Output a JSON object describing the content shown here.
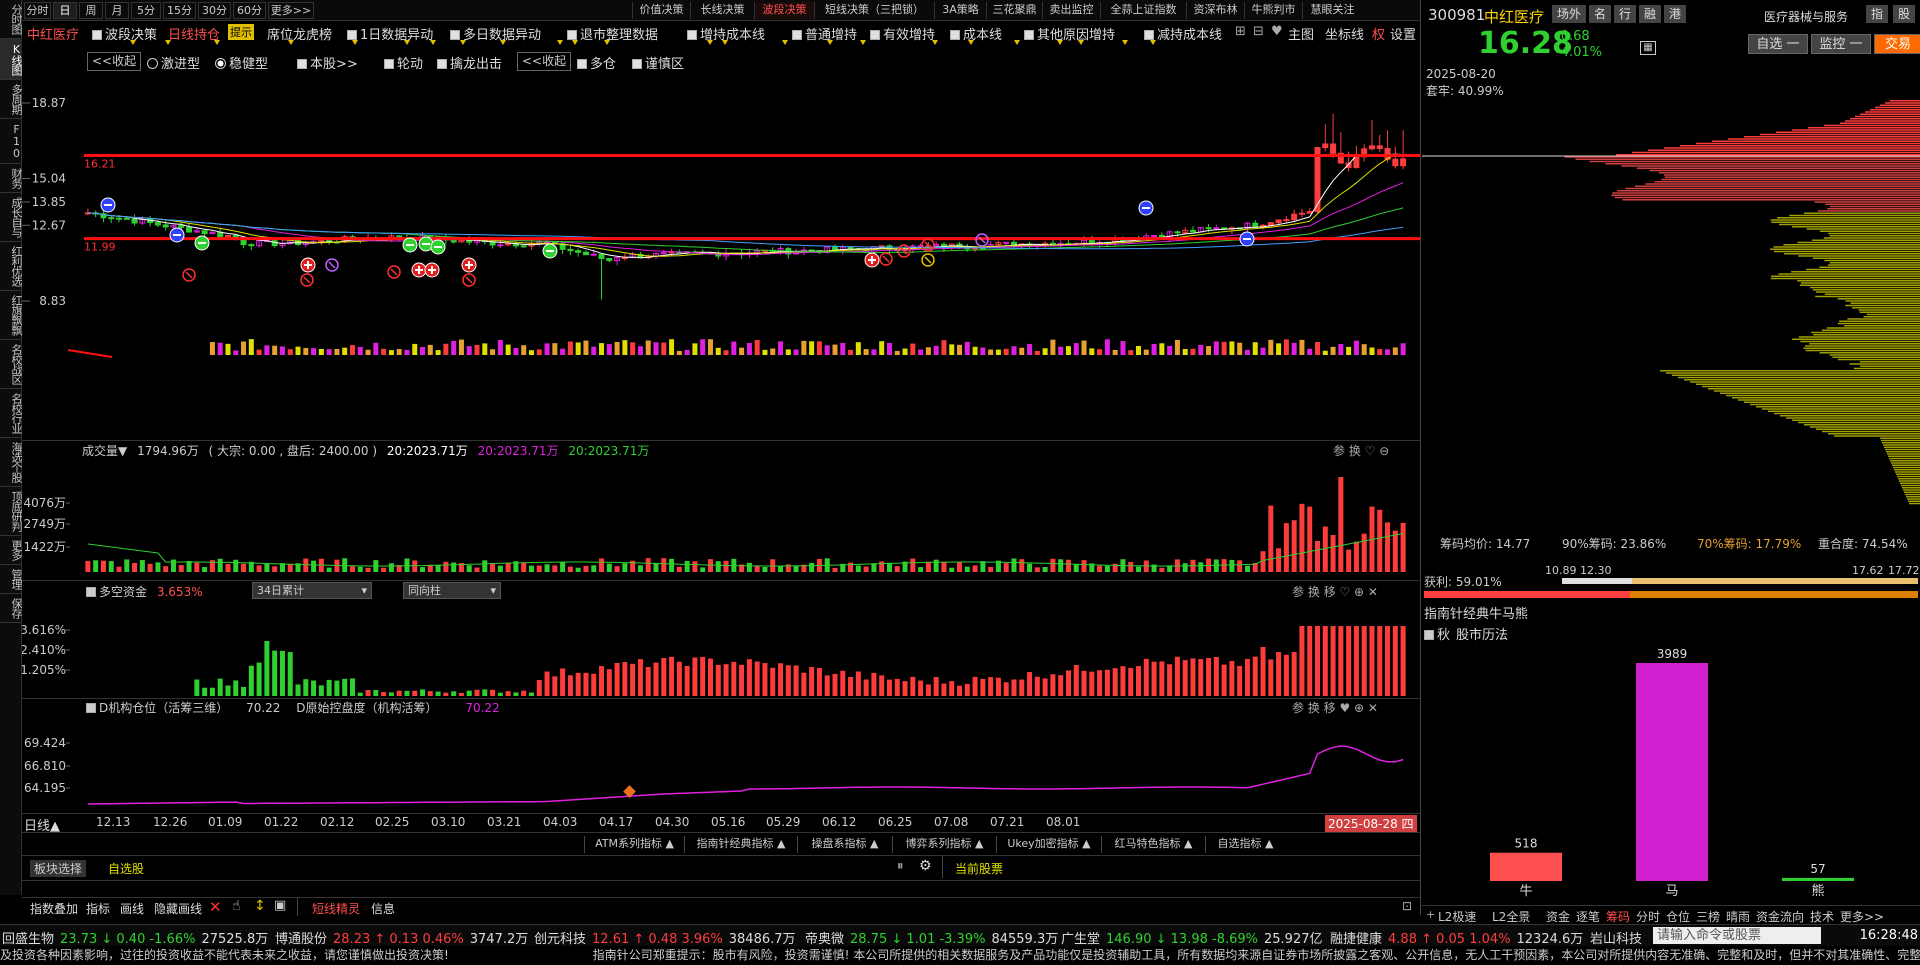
{
  "left_sidebar": [
    "分时图",
    "K线图",
    "多周期",
    "F10",
    "财务",
    "成长自与",
    "红利优选",
    "红旗飘飘",
    "名校战区",
    "名校行业",
    "海选个股",
    "顶底研判",
    "更多",
    "管理",
    "保存"
  ],
  "period_tabs": [
    "分时",
    "日",
    "周",
    "月",
    "5分",
    "15分",
    "30分",
    "60分",
    "更多>>"
  ],
  "strategy_tabs": [
    "价值决策",
    "长线决策",
    "波段决策",
    "短线决策（三把锁）",
    "3A策略",
    "三花聚鼎",
    "卖出监控",
    "全蒜上证指数",
    "资深布林",
    "牛熊判市",
    "慧眼关注"
  ],
  "stock": {
    "name": "中红医疗",
    "code": "300981",
    "industry": "医疗器械与服务",
    "price": "16.28",
    "change": "-0.68",
    "change_pct": "-4.01%",
    "date": "2025-08-20",
    "trapped": "套牢: 40.99%"
  },
  "toolbar2": {
    "items": [
      "波段决策",
      "日线持仓",
      "提示",
      "席位龙虎榜",
      "1日数据异动",
      "多日数据异动",
      "退市整理数据",
      "增持成本线",
      "普通增持",
      "有效增持",
      "成本线",
      "其他原因增持",
      "减持成本线",
      "主图",
      "坐标线",
      "权",
      "设置"
    ]
  },
  "toolbar3": {
    "collapse": "<<收起",
    "radical": "激进型",
    "stable": "稳健型",
    "this_stock": "本股>>",
    "rotate": "轮动",
    "catch_dragon": "擒龙出击",
    "collapse2": "<<收起",
    "long_short": "多仓",
    "caution": "谨慎区"
  },
  "main_chart": {
    "y_ticks": [
      "18.87",
      "15.04",
      "13.85",
      "12.67",
      "8.83"
    ],
    "line_upper": "16.21",
    "line_lower": "11.99"
  },
  "volume_panel": {
    "title": "成交量",
    "value": "1794.96万",
    "big": "( 大宗: 0.00 , 盘后: 2400.00 )",
    "ma1": "20:2023.71万",
    "ma2": "20:2023.71万",
    "ma3": "20:2023.71万",
    "y_ticks": [
      "4076万",
      "2749万",
      "1422万"
    ],
    "icons": "参 换 ♡ ⊖"
  },
  "fund_panel": {
    "title": "多空资金",
    "value": "3.653%",
    "select1": "34日累计",
    "select2": "同向柱",
    "y_ticks": [
      "3.616%",
      "2.410%",
      "1.205%"
    ],
    "icons": "参 换 移 ♡ ⊕ ✕"
  },
  "inst_panel": {
    "title": "D机构仓位（活筹三维）",
    "value": "70.22",
    "title2": "D原始控盘度（机构活筹）",
    "value2": "70.22",
    "y_ticks": [
      "69.424",
      "66.810",
      "64.195"
    ],
    "icons": "参 换 移 ♥ ⊕ ✕"
  },
  "x_axis": {
    "period": "日线▲",
    "dates": [
      "12.13",
      "12.26",
      "01.09",
      "01.22",
      "02.12",
      "02.25",
      "03.10",
      "03.21",
      "04.03",
      "04.17",
      "04.30",
      "05.16",
      "05.29",
      "06.12",
      "06.25",
      "07.08",
      "07.21",
      "08.01"
    ],
    "current": "2025-08-28 四"
  },
  "indicator_tabs": [
    "ATM系列指标 ▲",
    "指南针经典指标 ▲",
    "操盘系指标 ▲",
    "博弈系列指标 ▲",
    "Ukey加密指标 ▲",
    "红马特色指标 ▲",
    "自选指标 ▲"
  ],
  "lower_bar": {
    "block_select": "板块选择",
    "watchlist": "自选股",
    "current_stock": "当前股票"
  },
  "bottom_tools": [
    "指数叠加",
    "指标",
    "画线",
    "隐藏画线",
    "短线精灵",
    "信息"
  ],
  "right_top_buttons": [
    "场外",
    "名",
    "行",
    "融",
    "港"
  ],
  "right_top2": [
    "指",
    "股"
  ],
  "right_btns": [
    "自选 一",
    "监控 一",
    "交易"
  ],
  "chip_stats": {
    "avg": "筹码均价: 14.77",
    "c90": "90%筹码: 23.86%",
    "c70": "70%筹码: 17.79%",
    "overlap": "重合度: 74.54%",
    "profit": "获利: 59.01%",
    "p1": "10.89",
    "p2": "12.30",
    "p3": "17.62",
    "p4": "17.72"
  },
  "bull_panel": {
    "title": "指南针经典牛马熊",
    "subtitle": "股市历法",
    "bars": [
      {
        "label": "牛",
        "value": 518
      },
      {
        "label": "马",
        "value": 3989
      },
      {
        "label": "熊",
        "value": 57
      }
    ]
  },
  "right_bottom_tabs": [
    "L2极速",
    "L2全景",
    "资金",
    "逐笔",
    "筹码",
    "分时",
    "仓位",
    "三榜",
    "晴雨",
    "资金流向",
    "技术",
    "更多>>"
  ],
  "ticker": [
    {
      "name": "回盛生物",
      "price": "23.73",
      "dir": "↓",
      "chg": "0.40",
      "pct": "-1.66%",
      "amt": "27525.8万"
    },
    {
      "name": "博通股份",
      "price": "28.23",
      "dir": "↑",
      "chg": "0.13",
      "pct": "0.46%",
      "amt": "3747.2万"
    },
    {
      "name": "创元科技",
      "price": "12.61",
      "dir": "↑",
      "chg": "0.48",
      "pct": "3.96%",
      "amt": "38486.7万"
    },
    {
      "name": "帝奥微",
      "price": "28.75",
      "dir": "↓",
      "chg": "1.01",
      "pct": "-3.39%",
      "amt": "84559.3万"
    },
    {
      "name": "广生堂",
      "price": "146.90",
      "dir": "↓",
      "chg": "13.98",
      "pct": "-8.69%",
      "amt": "25.927亿"
    },
    {
      "name": "融捷健康",
      "price": "4.88",
      "dir": "↑",
      "chg": "0.05",
      "pct": "1.04%",
      "amt": "12324.6万"
    },
    {
      "name": "岩山科技",
      "price": "",
      "dir": "",
      "chg": "",
      "pct": "",
      "amt": ""
    }
  ],
  "command_input": "请输入命令或股票",
  "clock": "16:28:48",
  "disclaimer": "及投资各种因素影响，过往的投资收益不能代表未来之收益，请您谨慎做出投资决策!",
  "disclaimer2": "指南针公司郑重提示：股市有风险，投资需谨慎! 本公司所提供的相关数据服务及产品功能仅是投资辅助工具，所有数据均来源自证券市场所披露之客观、公开信息，无人工干预因素，本公司对所提供内容无准确、完整和及时，但并不对其准确性、完整",
  "colors": {
    "red": "#ff3c3c",
    "green": "#2fd02f",
    "magenta": "#e020e0",
    "yellow": "#e0e000",
    "bg": "#000000"
  }
}
